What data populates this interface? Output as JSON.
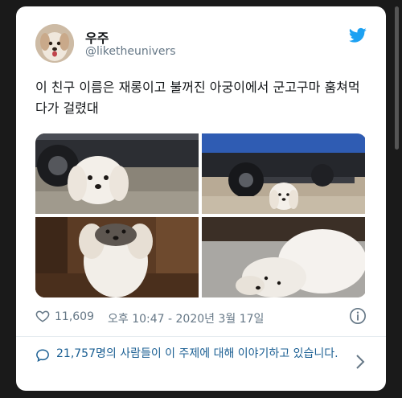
{
  "tweet": {
    "display_name": "우주",
    "handle": "@liketheunivers",
    "text": "이 친구 이름은 재롱이고 불꺼진 아궁이에서 군고구마 훔쳐먹다가 걸렸대",
    "likes": "11,609",
    "timestamp": "오후 10:47 - 2020년 3월 17일"
  },
  "discussion": {
    "text": "21,757명의 사람들이 이 주제에 대해 이야기하고 있습니다."
  },
  "icons": {
    "twitter": "twitter-bird-icon",
    "like": "heart-icon",
    "info": "info-icon",
    "discussion": "speech-bubble-icon",
    "chevron": "chevron-right-icon"
  },
  "colors": {
    "twitter_blue": "#1da1f2",
    "link_blue": "#1b5f93",
    "secondary_text": "#657786",
    "primary_text": "#14171a"
  }
}
